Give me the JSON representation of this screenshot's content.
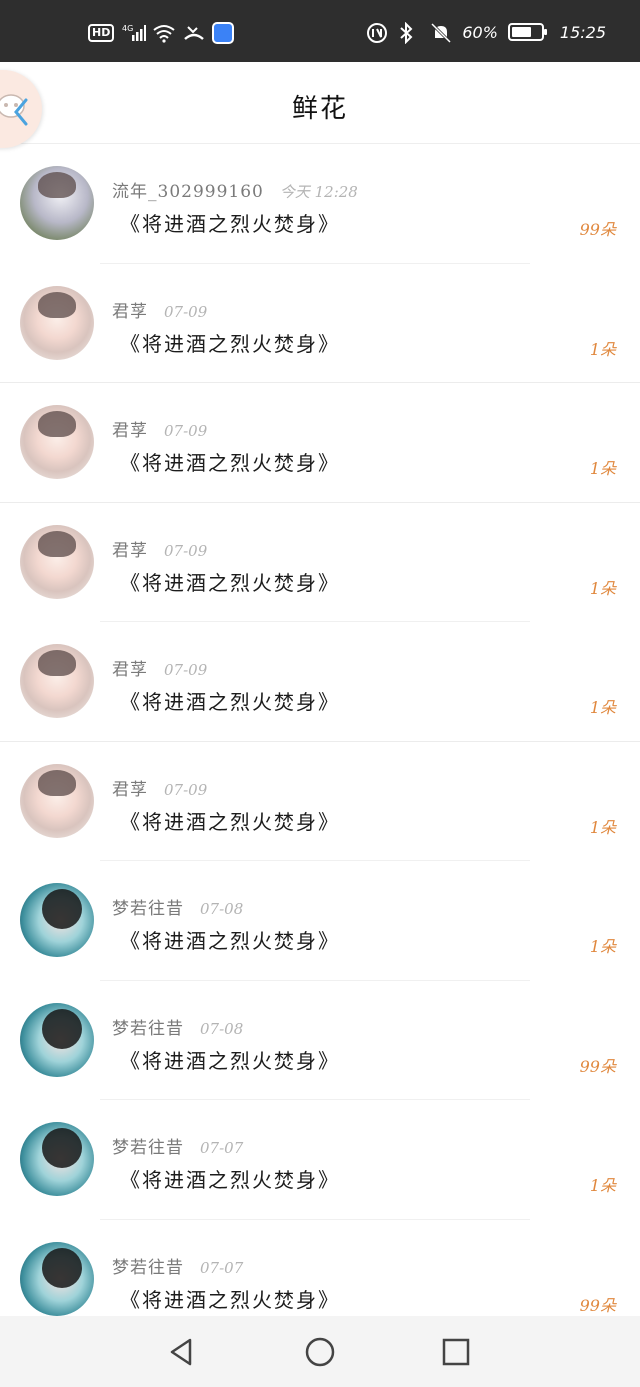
{
  "status_bar": {
    "hd": "HD",
    "network": "4G",
    "battery": "60%",
    "time": "15:25"
  },
  "header": {
    "title": "鲜花"
  },
  "colors": {
    "accent_count": "#e0883e",
    "name_gray": "#7a7a7a",
    "time_gray": "#b4b4b4"
  },
  "rows": [
    {
      "name": "流年_302999160",
      "time": "今天 12:28",
      "book": "《将进酒之烈火焚身》",
      "count": "99朵",
      "avatar": "avatar-1"
    },
    {
      "name": "君莩",
      "time": "07-09",
      "book": "《将进酒之烈火焚身》",
      "count": "1朵",
      "avatar": "avatar-2"
    },
    {
      "name": "君莩",
      "time": "07-09",
      "book": "《将进酒之烈火焚身》",
      "count": "1朵",
      "avatar": "avatar-2"
    },
    {
      "name": "君莩",
      "time": "07-09",
      "book": "《将进酒之烈火焚身》",
      "count": "1朵",
      "avatar": "avatar-2"
    },
    {
      "name": "君莩",
      "time": "07-09",
      "book": "《将进酒之烈火焚身》",
      "count": "1朵",
      "avatar": "avatar-2"
    },
    {
      "name": "君莩",
      "time": "07-09",
      "book": "《将进酒之烈火焚身》",
      "count": "1朵",
      "avatar": "avatar-2"
    },
    {
      "name": "梦若往昔",
      "time": "07-08",
      "book": "《将进酒之烈火焚身》",
      "count": "1朵",
      "avatar": "avatar-3"
    },
    {
      "name": "梦若往昔",
      "time": "07-08",
      "book": "《将进酒之烈火焚身》",
      "count": "99朵",
      "avatar": "avatar-3"
    },
    {
      "name": "梦若往昔",
      "time": "07-07",
      "book": "《将进酒之烈火焚身》",
      "count": "1朵",
      "avatar": "avatar-3"
    },
    {
      "name": "梦若往昔",
      "time": "07-07",
      "book": "《将进酒之烈火焚身》",
      "count": "99朵",
      "avatar": "avatar-3"
    }
  ],
  "icons": {
    "back": "chevron-left-icon",
    "nav_back": "triangle-back-icon",
    "nav_home": "circle-home-icon",
    "nav_recent": "square-recent-icon"
  }
}
